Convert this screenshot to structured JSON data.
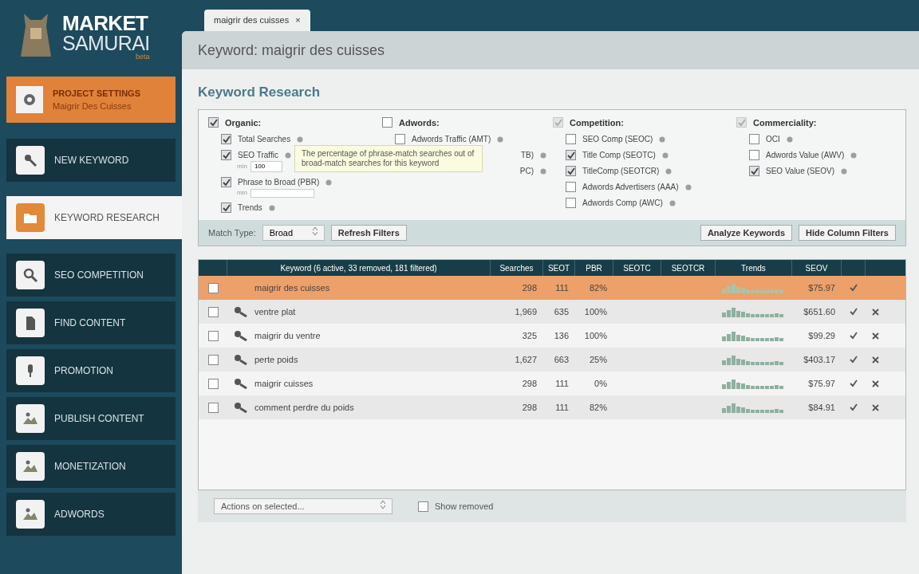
{
  "logo": {
    "line_1": "MARKET",
    "line_2": "SAMURAI",
    "badge": "beta"
  },
  "project": {
    "title": "PROJECT SETTINGS",
    "name": "Maigrir Des Cuisses"
  },
  "nav": [
    {
      "label": "NEW KEYWORD",
      "kind": "key",
      "selected": false
    },
    {
      "label": "KEYWORD RESEARCH",
      "kind": "folder",
      "selected": true
    },
    {
      "label": "SEO COMPETITION",
      "kind": "search",
      "selected": false
    },
    {
      "label": "FIND CONTENT",
      "kind": "doc",
      "selected": false
    },
    {
      "label": "PROMOTION",
      "kind": "mic",
      "selected": false
    },
    {
      "label": "PUBLISH CONTENT",
      "kind": "picture",
      "selected": false
    },
    {
      "label": "MONETIZATION",
      "kind": "picture",
      "selected": false
    },
    {
      "label": "ADWORDS",
      "kind": "picture",
      "selected": false
    }
  ],
  "tab": {
    "label": "maigrir des cuisses",
    "close": "×"
  },
  "header": "Keyword: maigrir des cuisses",
  "section_title": "Keyword Research",
  "filter_groups": [
    {
      "label": "Organic:",
      "checked": true,
      "items": [
        {
          "label": "Total Searches",
          "checked": true
        },
        {
          "label": "SEO Traffic",
          "checked": true,
          "min_label": "min",
          "min_value": "100"
        },
        {
          "label": "Phrase to Broad (PBR)",
          "checked": true,
          "min_label": "min"
        },
        {
          "label": "Trends",
          "checked": true
        }
      ]
    },
    {
      "label": "Adwords:",
      "checked": false,
      "items": [
        {
          "label": "Adwords Traffic (AMT)",
          "checked": false
        },
        {
          "label": "TB)"
        },
        {
          "label": "PC)"
        }
      ]
    },
    {
      "label": "Competition:",
      "checked": true,
      "items": [
        {
          "label": "SEO Comp (SEOC)",
          "checked": false
        },
        {
          "label": "Title Comp (SEOTC)",
          "checked": true
        },
        {
          "label": "TitleComp (SEOTCR)",
          "checked": true
        },
        {
          "label": "Adwords Advertisers (AAA)",
          "checked": false
        },
        {
          "label": "Adwords Comp (AWC)",
          "checked": false
        }
      ]
    },
    {
      "label": "Commerciality:",
      "checked": true,
      "items": [
        {
          "label": "OCI",
          "checked": false
        },
        {
          "label": "Adwords Value (AWV)",
          "checked": false
        },
        {
          "label": "SEO Value (SEOV)",
          "checked": true
        }
      ]
    }
  ],
  "tooltip": "The percentage of phrase-match searches out of broad-match searches for this keyword",
  "filter_bar": {
    "match_label": "Match Type:",
    "match_value": "Broad",
    "refresh": "Refresh Filters",
    "analyze": "Analyze Keywords",
    "hide": "Hide Column Filters"
  },
  "table": {
    "columns": [
      "Keyword (6 active, 33 removed, 181 filtered)",
      "Searches",
      "SEOT",
      "PBR",
      "SEOTC",
      "SEOTCR",
      "Trends",
      "SEOV"
    ],
    "rows": [
      {
        "keyword": "maigrir des cuisses",
        "searches": "298",
        "seot": "111",
        "pbr": "82%",
        "seov": "$75.97",
        "selected": true,
        "seed": true
      },
      {
        "keyword": "ventre plat",
        "searches": "1,969",
        "seot": "635",
        "pbr": "100%",
        "seov": "$651.60",
        "selected": false,
        "seed": false
      },
      {
        "keyword": "maigrir du ventre",
        "searches": "325",
        "seot": "136",
        "pbr": "100%",
        "seov": "$99.29",
        "selected": false,
        "seed": false
      },
      {
        "keyword": "perte poids",
        "searches": "1,627",
        "seot": "663",
        "pbr": "25%",
        "seov": "$403.17",
        "selected": false,
        "seed": false
      },
      {
        "keyword": "maigrir cuisses",
        "searches": "298",
        "seot": "111",
        "pbr": "0%",
        "seov": "$75.97",
        "selected": false,
        "seed": false
      },
      {
        "keyword": "comment perdre du poids",
        "searches": "298",
        "seot": "111",
        "pbr": "82%",
        "seov": "$84.91",
        "selected": false,
        "seed": false
      }
    ]
  },
  "footer": {
    "actions": "Actions on selected...",
    "show_removed": "Show removed",
    "show_removed_checked": false
  }
}
